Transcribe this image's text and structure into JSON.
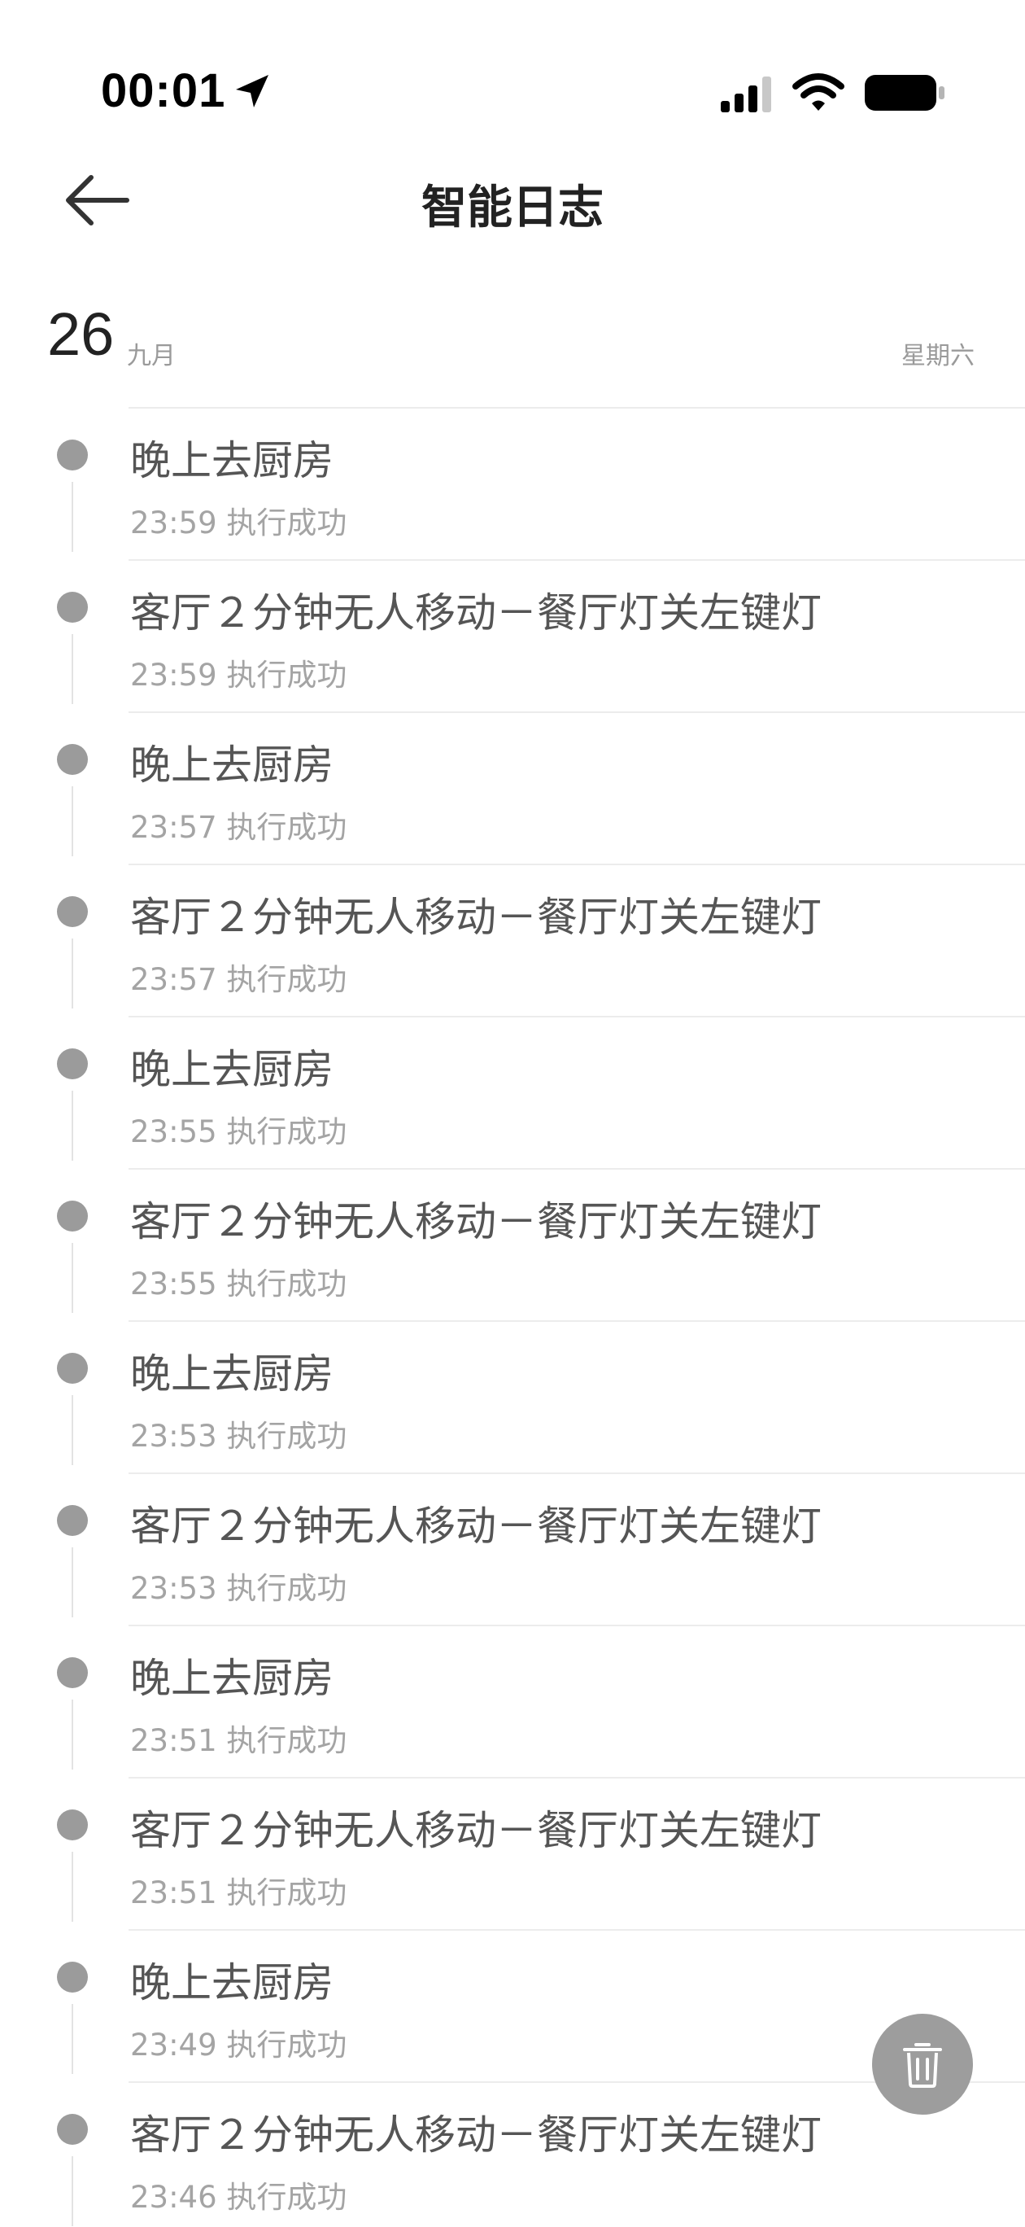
{
  "status_bar": {
    "time": "00:01",
    "icons": [
      "location-arrow-icon",
      "cellular-signal-icon",
      "wifi-icon",
      "battery-icon"
    ]
  },
  "header": {
    "title": "智能日志",
    "back_icon": "arrow-left-icon"
  },
  "date": {
    "day": "26",
    "month": "九月",
    "weekday": "星期六"
  },
  "logs": [
    {
      "title": "晚上去厨房",
      "time": "23:59",
      "status": "执行成功"
    },
    {
      "title": "客厅２分钟无人移动－餐厅灯关左键灯",
      "time": "23:59",
      "status": "执行成功"
    },
    {
      "title": "晚上去厨房",
      "time": "23:57",
      "status": "执行成功"
    },
    {
      "title": "客厅２分钟无人移动－餐厅灯关左键灯",
      "time": "23:57",
      "status": "执行成功"
    },
    {
      "title": "晚上去厨房",
      "time": "23:55",
      "status": "执行成功"
    },
    {
      "title": "客厅２分钟无人移动－餐厅灯关左键灯",
      "time": "23:55",
      "status": "执行成功"
    },
    {
      "title": "晚上去厨房",
      "time": "23:53",
      "status": "执行成功"
    },
    {
      "title": "客厅２分钟无人移动－餐厅灯关左键灯",
      "time": "23:53",
      "status": "执行成功"
    },
    {
      "title": "晚上去厨房",
      "time": "23:51",
      "status": "执行成功"
    },
    {
      "title": "客厅２分钟无人移动－餐厅灯关左键灯",
      "time": "23:51",
      "status": "执行成功"
    },
    {
      "title": "晚上去厨房",
      "time": "23:49",
      "status": "执行成功"
    },
    {
      "title": "客厅２分钟无人移动－餐厅灯关左键灯",
      "time": "23:46",
      "status": "执行成功"
    }
  ],
  "delete_button": {
    "icon": "trash-icon"
  },
  "colors": {
    "dot": "#9b9b9b",
    "title_text": "#555555",
    "sub_text": "#a4a4a4",
    "fab": "#9d9d9d"
  }
}
